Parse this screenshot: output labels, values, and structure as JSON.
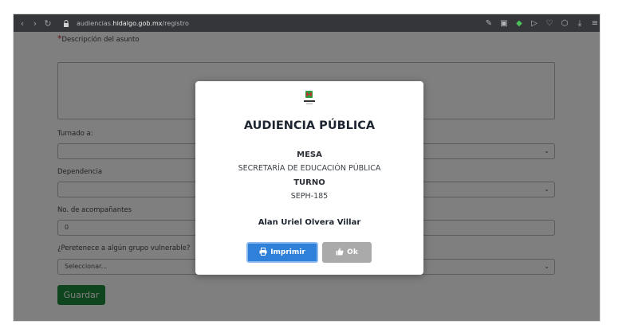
{
  "browser": {
    "back_icon": "chevron-left",
    "forward_icon": "chevron-right",
    "reload_icon": "reload",
    "url_host": "audiencias.hidalgo.gob.mx",
    "url_path": "/registro",
    "url_prefix": "audiencias.",
    "url_domain": "hidalgo.gob.mx",
    "toolbar_icons": [
      "edit-icon",
      "camera-icon",
      "shield-check-icon",
      "send-icon",
      "heart-icon",
      "extension-icon",
      "download-icon",
      "menu-icon"
    ]
  },
  "form": {
    "descripcion_label": "Descripción del asunto",
    "required_mark": "*",
    "turnado_label": "Turnado a:",
    "dependencia_label": "Dependencia",
    "acompanantes_label": "No. de acompañantes",
    "acompanantes_value": "0",
    "vulnerable_label": "¿Peretenece a algún grupo vulnerable?",
    "vulnerable_value": "Seleccionar...",
    "guardar_label": "Guardar"
  },
  "modal": {
    "title": "AUDIENCIA PÚBLICA",
    "mesa_label": "MESA",
    "mesa_value": "SECRETARÍA DE EDUCACIÓN PÚBLICA",
    "turno_label": "TURNO",
    "turno_value": "SEPH-185",
    "person_name": "Alan Uriel Olvera Villar",
    "print_label": "Imprimir",
    "ok_label": "Ok",
    "logo_text": "HIDALGO"
  },
  "colors": {
    "print_button": "#2f80d8",
    "ok_button": "#aaaaaa",
    "guardar_button": "#1e8a3c",
    "browser_bar": "#35363a"
  }
}
